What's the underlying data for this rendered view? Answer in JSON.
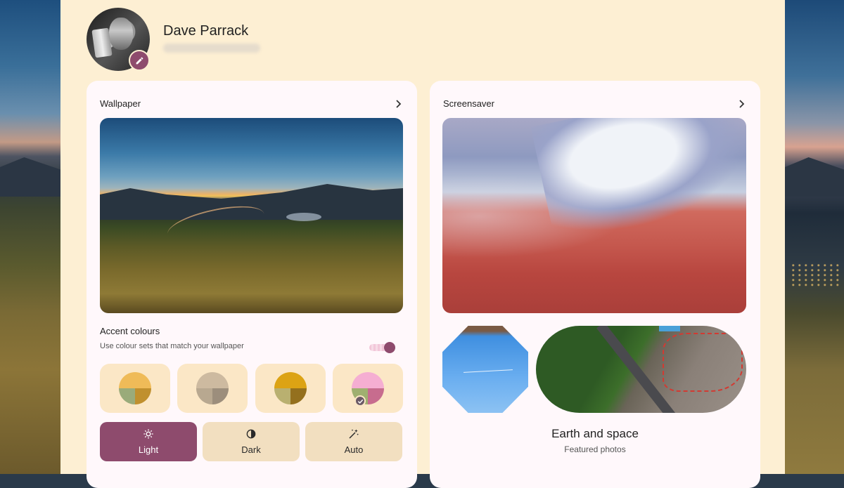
{
  "profile": {
    "name": "Dave Parrack",
    "avatar_icon": "user-photo",
    "edit_icon": "pencil-icon"
  },
  "wallpaper": {
    "title": "Wallpaper",
    "open_icon": "chevron-right-icon"
  },
  "accent": {
    "title": "Accent colours",
    "subtitle": "Use colour sets that match your wallpaper",
    "toggle_on": true,
    "swatches": [
      {
        "top": "#efbb58",
        "bottom_left": "#9aab7a",
        "bottom_right": "#c0902e",
        "selected": false
      },
      {
        "top": "#cdbaa0",
        "bottom_left": "#b8a890",
        "bottom_right": "#9c8e7c",
        "selected": false
      },
      {
        "top": "#dca314",
        "bottom_left": "#b9b070",
        "bottom_right": "#94701e",
        "selected": false
      },
      {
        "top": "#f5aed2",
        "bottom_left": "#9fb070",
        "bottom_right": "#c76c8e",
        "selected": true
      }
    ]
  },
  "mode": {
    "options": [
      {
        "label": "Light",
        "icon": "brightness-icon",
        "selected": true
      },
      {
        "label": "Dark",
        "icon": "contrast-icon",
        "selected": false
      },
      {
        "label": "Auto",
        "icon": "magic-wand-icon",
        "selected": false
      }
    ]
  },
  "screensaver": {
    "title": "Screensaver",
    "open_icon": "chevron-right-icon",
    "album_title": "Earth and space",
    "album_subtitle": "Featured photos"
  },
  "colors": {
    "panel_bg": "#fdefd3",
    "card_bg": "#fff8fb",
    "accent": "#8e4b6d",
    "button_bg": "#f2dfc0"
  }
}
